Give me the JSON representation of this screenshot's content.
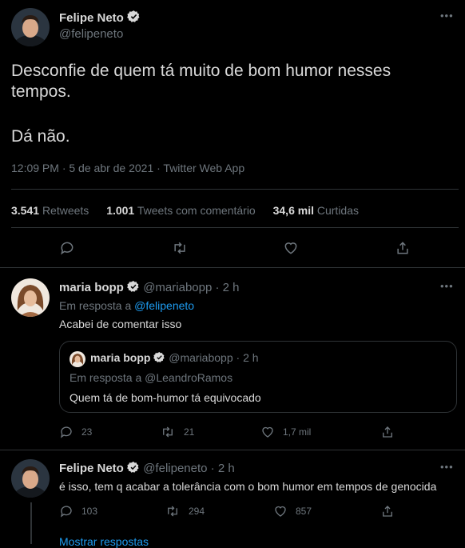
{
  "main_tweet": {
    "author_name": "Felipe Neto",
    "author_handle": "@felipeneto",
    "text_line1": "Desconfie de quem tá muito de bom humor nesses",
    "text_line2": "tempos.",
    "text_line3": "Dá não.",
    "meta": "12:09 PM · 5 de abr de 2021 · Twitter Web App",
    "stats": {
      "retweets_value": "3.541",
      "retweets_label": "Retweets",
      "quotes_value": "1.001",
      "quotes_label": "Tweets com comentário",
      "likes_value": "34,6 mil",
      "likes_label": "Curtidas"
    }
  },
  "reply1": {
    "author_name": "maria bopp",
    "author_handle": "@mariabopp",
    "time": "· 2 h",
    "reply_prefix": "Em resposta a",
    "reply_to": "@felipeneto",
    "text": "Acabei de comentar isso",
    "quote": {
      "author_name": "maria bopp",
      "author_handle": "@mariabopp",
      "time": "· 2 h",
      "reply_line": "Em resposta a @LeandroRamos",
      "text": "Quem tá de bom-humor tá equivocado"
    },
    "replies": "23",
    "retweets": "21",
    "likes": "1,7 mil"
  },
  "reply2": {
    "author_name": "Felipe Neto",
    "author_handle": "@felipeneto",
    "time": "· 2 h",
    "text": "é isso, tem q acabar a tolerância com o bom humor em tempos de genocida",
    "replies": "103",
    "retweets": "294",
    "likes": "857"
  },
  "show_replies": "Mostrar respostas",
  "colors": {
    "accent": "#1d9bf0",
    "background": "#000000",
    "muted": "#6e767d",
    "divider": "#2f3336"
  }
}
